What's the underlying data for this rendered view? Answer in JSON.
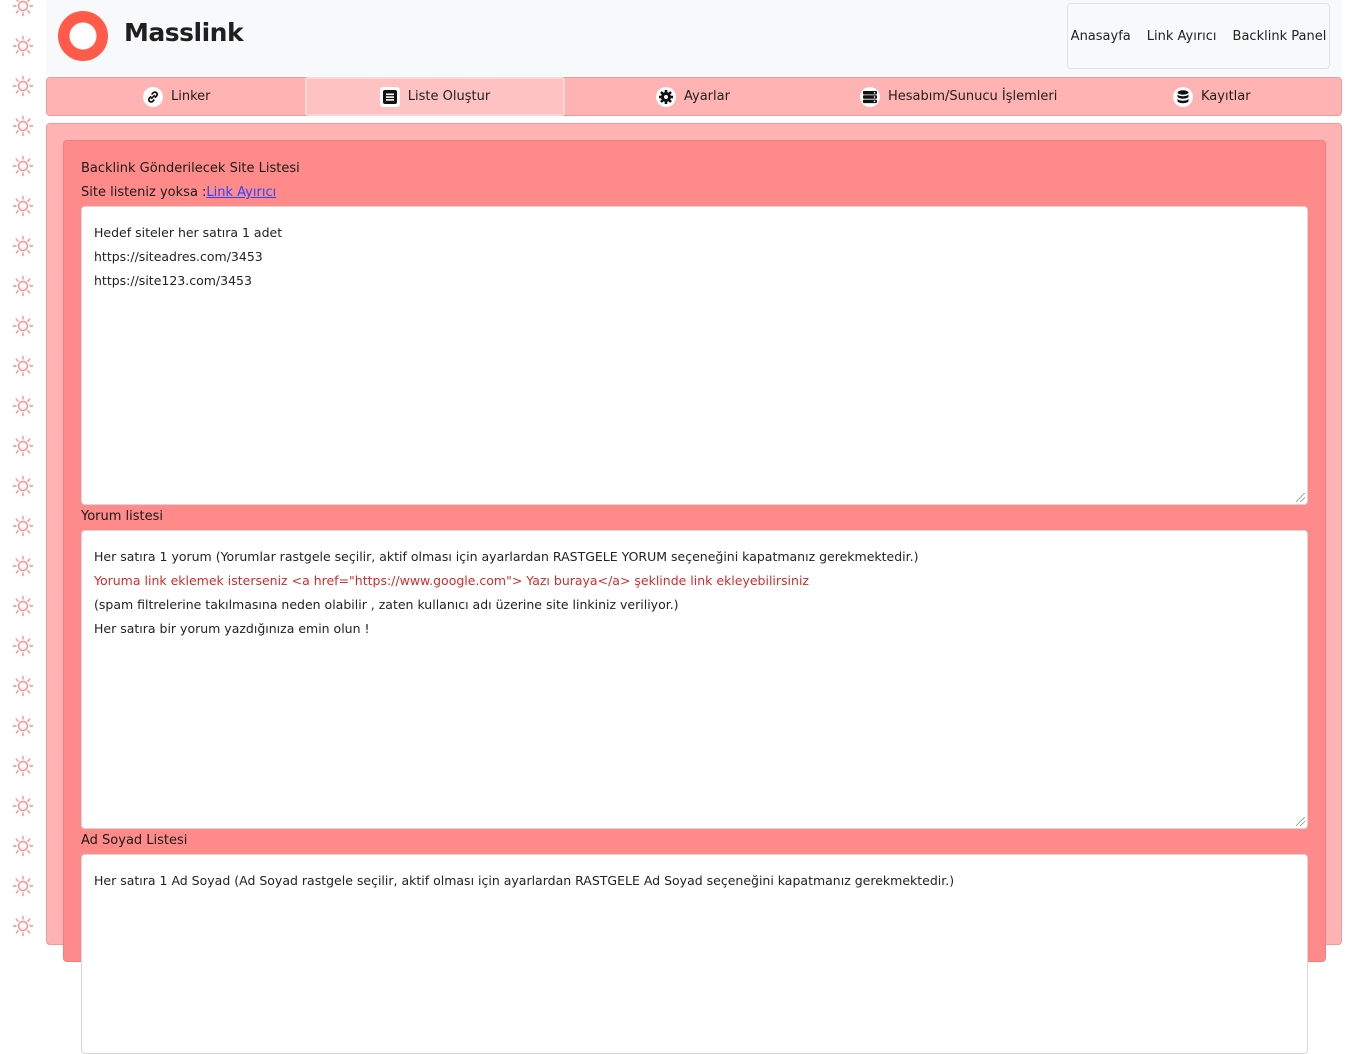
{
  "app": {
    "brand": "Masslink",
    "colors": {
      "accent": "#ff5a4a",
      "panel": "#ffb3b3",
      "inner_panel": "#ff8a8a"
    }
  },
  "topnav": {
    "items": [
      {
        "label": "Anasayfa"
      },
      {
        "label": "Link Ayırıcı"
      },
      {
        "label": "Backlink Panel"
      }
    ]
  },
  "tabs": [
    {
      "label": "Linker",
      "icon": "link-icon"
    },
    {
      "label": "Liste Oluştur",
      "icon": "list-icon",
      "active": true
    },
    {
      "label": "Ayarlar",
      "icon": "gear-icon"
    },
    {
      "label": "Hesabım/Sunucu İşlemleri",
      "icon": "server-icon"
    },
    {
      "label": "Kayıtlar",
      "icon": "database-icon"
    }
  ],
  "form": {
    "sites_title": "Backlink Gönderilecek Site Listesi",
    "sites_hint_prefix": "Site listeniz yoksa :",
    "sites_hint_link": "Link Ayırıcı",
    "sites_lines": [
      "Hedef siteler her satıra 1 adet",
      "https://siteadres.com/3453",
      "https://site123.com/3453"
    ],
    "comments_label": "Yorum listesi",
    "comments_lines": [
      "Her satıra 1 yorum (Yorumlar rastgele seçilir, aktif olması için ayarlardan RASTGELE YORUM seçeneğini kapatmanız gerekmektedir.)",
      "Yoruma link eklemek isterseniz <a href=\"https://www.google.com\"> Yazı buraya</a> şeklinde link ekleyebilirsiniz",
      "(spam filtrelerine takılmasına neden olabilir , zaten kullanıcı adı üzerine site linkiniz veriliyor.)",
      "Her satıra bir yorum yazdığınıza emin olun !"
    ],
    "names_label": "Ad Soyad Listesi",
    "names_lines": [
      "Her satıra 1 Ad Soyad (Ad Soyad rastgele seçilir, aktif olması için ayarlardan RASTGELE Ad Soyad seçeneğini kapatmanız gerekmektedir.)"
    ]
  }
}
